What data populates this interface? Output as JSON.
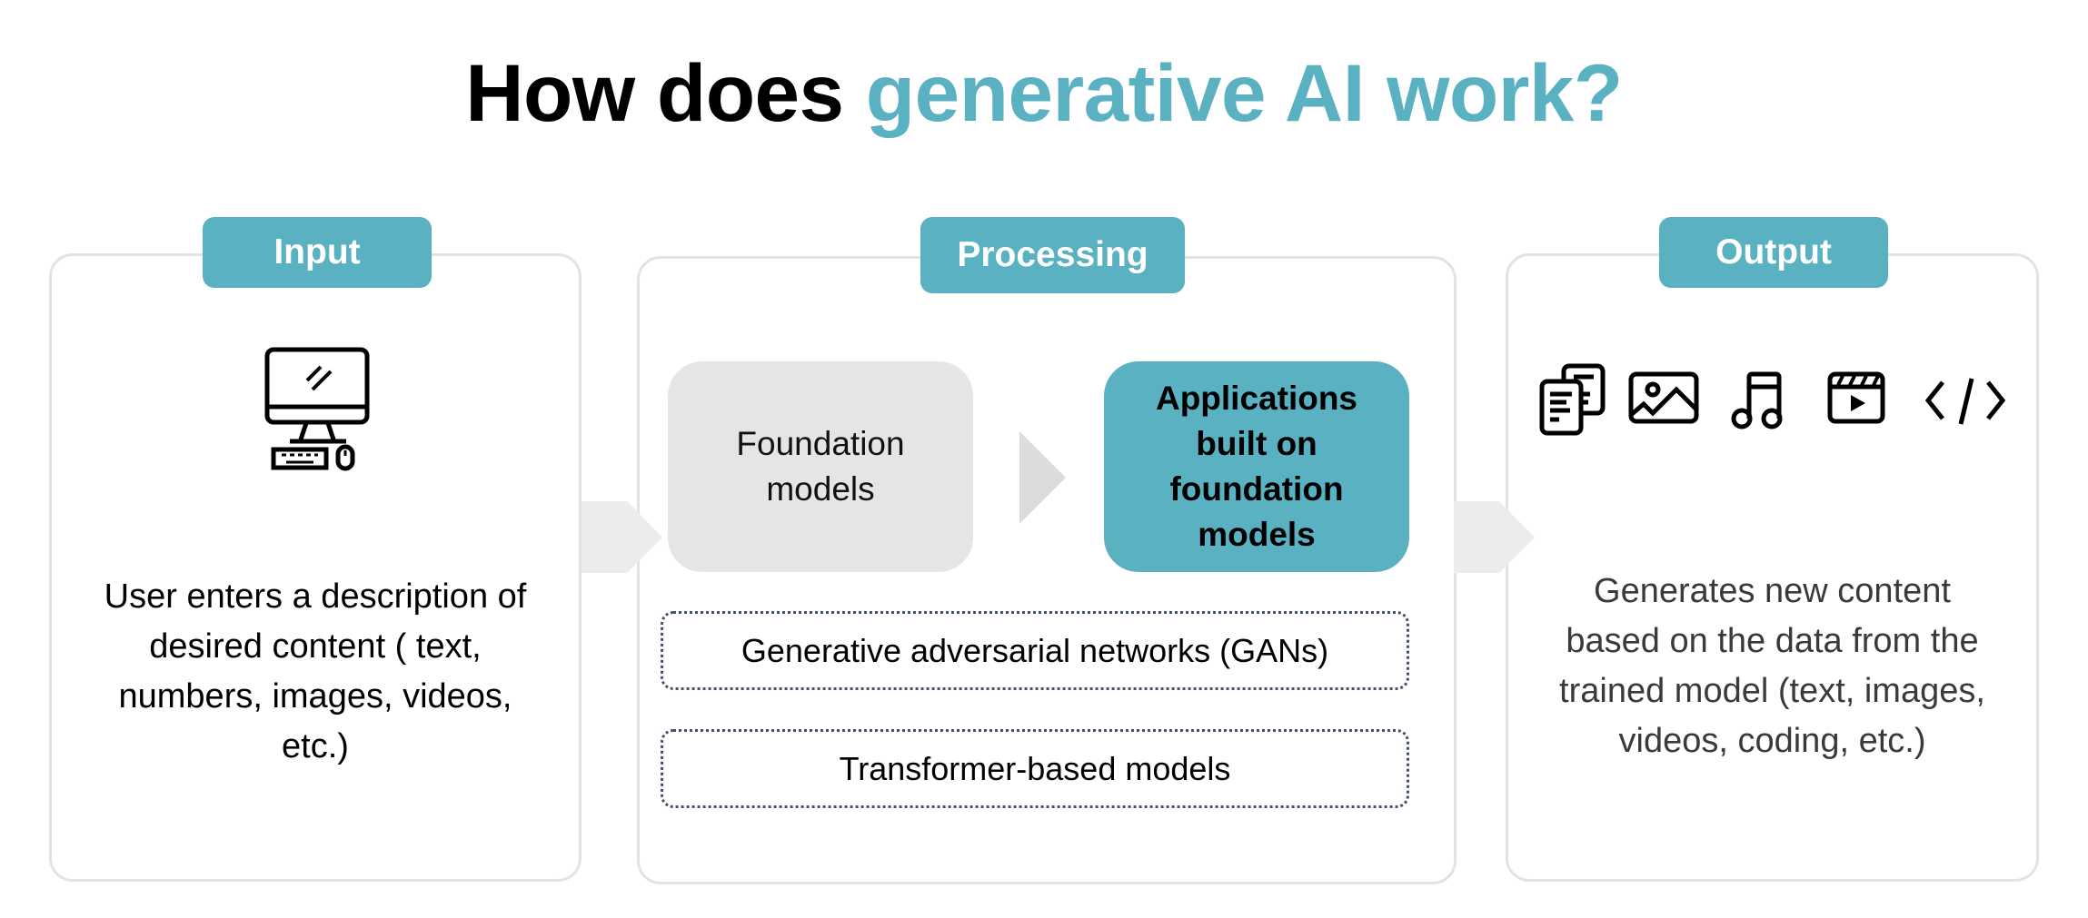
{
  "title": {
    "prefix": "How does ",
    "highlight": "generative AI work?"
  },
  "colors": {
    "accent": "#5ab1c1",
    "panel_border": "#e3e3e3",
    "arrow": "#ececec",
    "foundation_box": "#e5e5e5",
    "output_text": "#3a3a3a"
  },
  "input": {
    "label": "Input",
    "icon": "desktop-computer-icon",
    "description": "User enters a description of desired content ( text, numbers, images, videos, etc.)",
    "lines": [
      "User enters a description of",
      "desired content ( text,",
      "numbers, images, videos,",
      "etc.)"
    ]
  },
  "processing": {
    "label": "Processing",
    "foundation": {
      "lines": [
        "Foundation",
        "models"
      ]
    },
    "applications": {
      "lines": [
        "Applications",
        "built on",
        "foundation",
        "models"
      ]
    },
    "model_types": [
      "Generative adversarial networks (GANs)",
      "Transformer-based models"
    ]
  },
  "output": {
    "label": "Output",
    "icons": [
      "documents-icon",
      "image-icon",
      "music-note-icon",
      "video-clapperboard-icon",
      "code-icon"
    ],
    "lines": [
      "Generates new content",
      "based on the data from the",
      "trained model (text, images,",
      "videos, coding, etc.)"
    ]
  }
}
